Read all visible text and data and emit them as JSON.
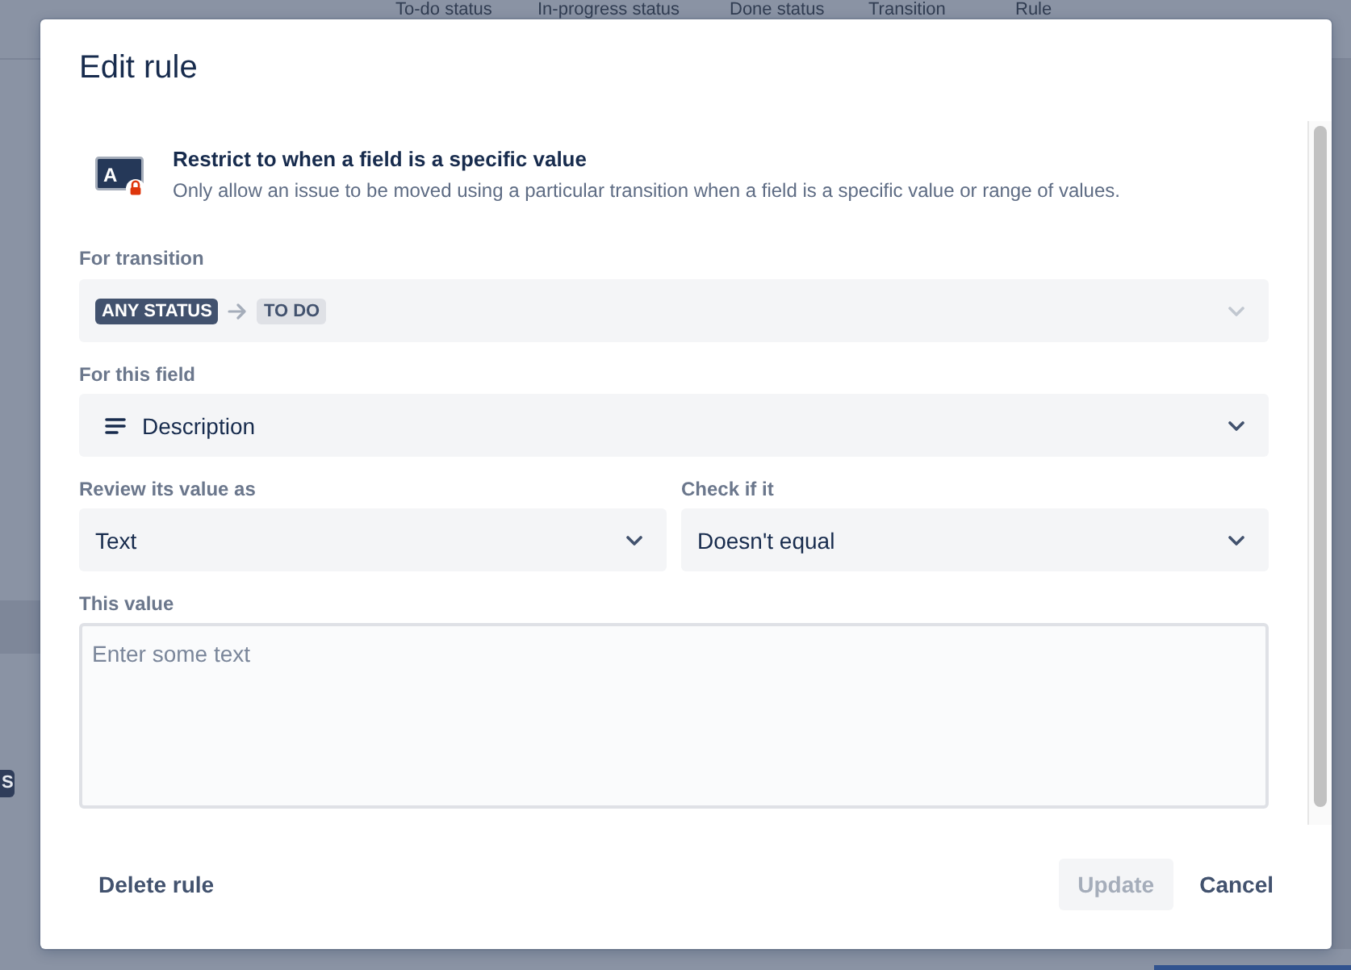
{
  "background_page": {
    "column_headers": [
      "To-do status",
      "In-progress status",
      "Done status",
      "Transition",
      "Rule"
    ],
    "partial_badge": "S"
  },
  "dialog": {
    "title": "Edit rule",
    "rule": {
      "icon_letter": "A",
      "title": "Restrict to when a field is a specific value",
      "description": "Only allow an issue to be moved using a particular transition when a field is a specific value or range of values."
    },
    "transition": {
      "label": "For transition",
      "from": "ANY STATUS",
      "to": "TO DO",
      "disabled": true
    },
    "field": {
      "label": "For this field",
      "value": "Description",
      "disabled": false
    },
    "review_as": {
      "label": "Review its value as",
      "value": "Text",
      "disabled": false
    },
    "check_if": {
      "label": "Check if it",
      "value": "Doesn't equal",
      "disabled": false
    },
    "this_value": {
      "label": "This value",
      "placeholder": "Enter some text"
    },
    "footer": {
      "left_buttons": [
        {
          "label": "Delete rule",
          "kind": "subtle",
          "disabled": false
        }
      ],
      "right_buttons": [
        {
          "label": "Update",
          "kind": "primary",
          "disabled": true
        },
        {
          "label": "Cancel",
          "kind": "subtle",
          "disabled": false
        }
      ]
    }
  }
}
